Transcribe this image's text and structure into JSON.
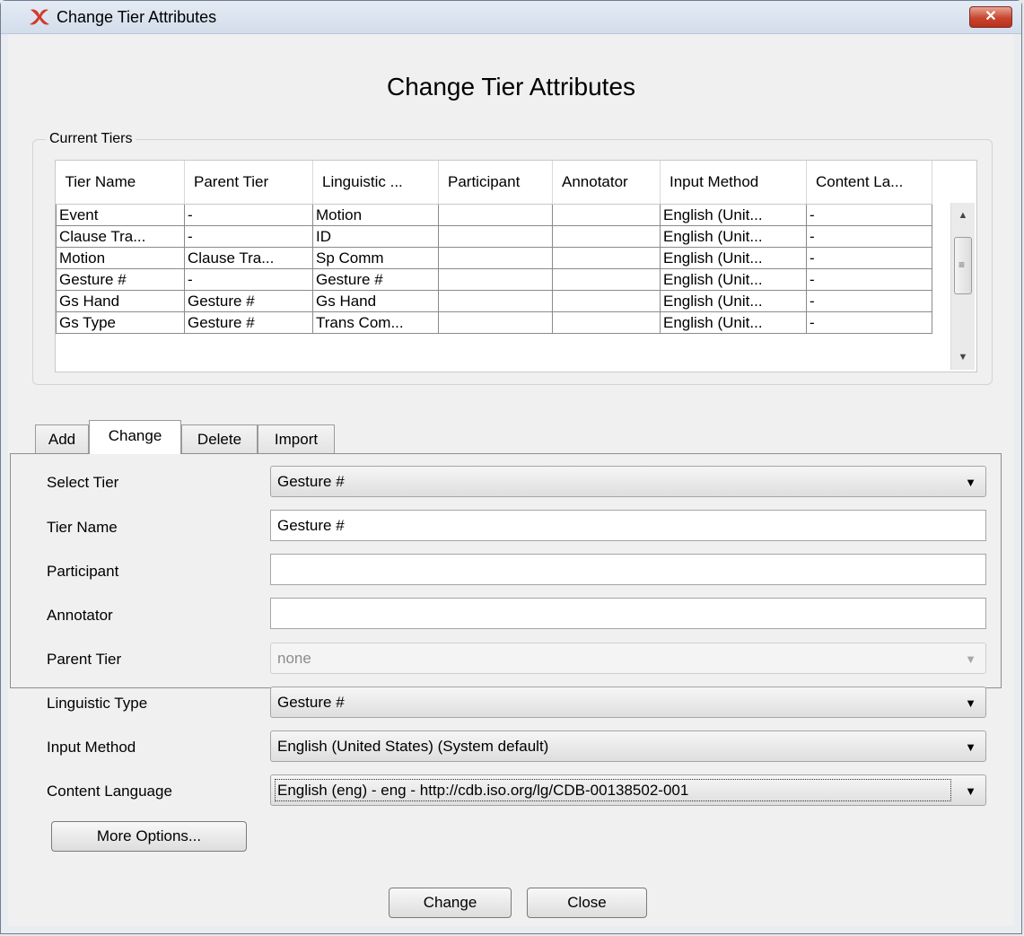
{
  "window": {
    "title": "Change Tier Attributes",
    "close_glyph": "✕"
  },
  "dialog": {
    "heading": "Change Tier Attributes"
  },
  "tiers": {
    "legend": "Current Tiers",
    "columns": [
      "Tier Name",
      "Parent Tier",
      "Linguistic ...",
      "Participant",
      "Annotator",
      "Input Method",
      "Content La..."
    ],
    "rows": [
      [
        "Event",
        "-",
        "Motion",
        "",
        "",
        "English (Unit...",
        "-"
      ],
      [
        "Clause Tra...",
        "-",
        "ID",
        "",
        "",
        "English (Unit...",
        "-"
      ],
      [
        "Motion",
        "Clause Tra...",
        "Sp Comm",
        "",
        "",
        "English (Unit...",
        "-"
      ],
      [
        "Gesture #",
        "-",
        "Gesture #",
        "",
        "",
        "English (Unit...",
        "-"
      ],
      [
        "Gs Hand",
        "Gesture #",
        "Gs Hand",
        "",
        "",
        "English (Unit...",
        "-"
      ],
      [
        "Gs Type",
        "Gesture #",
        "Trans Com...",
        "",
        "",
        "English (Unit...",
        "-"
      ]
    ]
  },
  "tabs": [
    "Add",
    "Change",
    "Delete",
    "Import"
  ],
  "active_tab": "Change",
  "form": {
    "select_tier": {
      "label": "Select Tier",
      "value": "Gesture #"
    },
    "tier_name": {
      "label": "Tier Name",
      "value": "Gesture #"
    },
    "participant": {
      "label": "Participant",
      "value": ""
    },
    "annotator": {
      "label": "Annotator",
      "value": ""
    },
    "parent_tier": {
      "label": "Parent Tier",
      "value": "none"
    },
    "linguistic_type": {
      "label": "Linguistic Type",
      "value": "Gesture #"
    },
    "input_method": {
      "label": "Input Method",
      "value": "English (United States) (System default)"
    },
    "content_language": {
      "label": "Content Language",
      "value": "English (eng) - eng - http://cdb.iso.org/lg/CDB-00138502-001"
    },
    "more_options_label": "More Options..."
  },
  "footer": {
    "change_label": "Change",
    "close_label": "Close"
  },
  "colors": {
    "titlebar": "#d3ddeb",
    "close_button": "#c9452e",
    "app_icon": "#d13a2a"
  }
}
